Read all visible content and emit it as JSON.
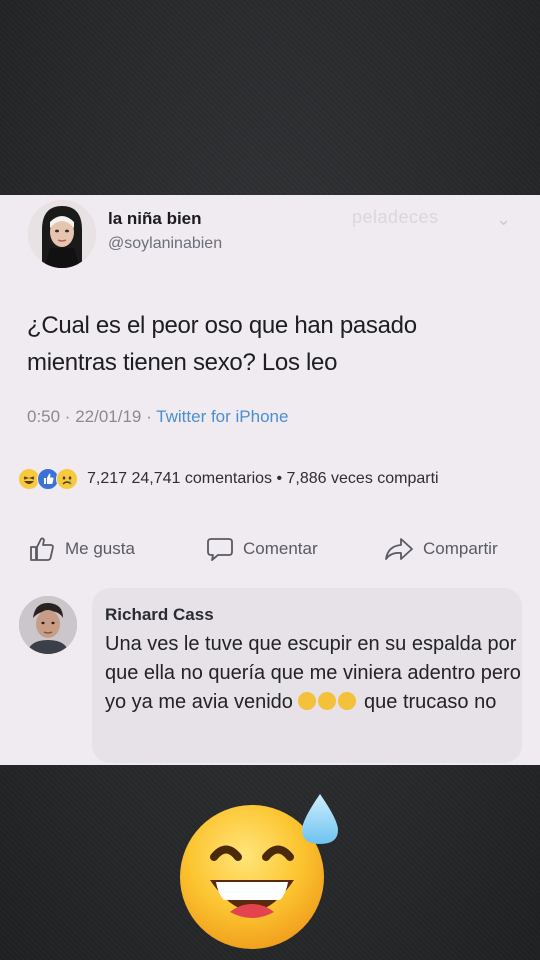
{
  "tweet": {
    "author_name": "la niña bien",
    "author_handle": "@soylaninabien",
    "watermark": "peladeces",
    "text": "¿Cual es el peor oso que han pasado mientras tienen sexo? Los leo",
    "time": "0:50 · 22/01/19 · ",
    "source": "Twitter for iPhone"
  },
  "post_stats": {
    "reactions": [
      "haha-icon",
      "like-icon",
      "sad-icon"
    ],
    "reaction_count": "7,217",
    "comments_text": "24,741 comentarios",
    "shares_text": "7,886 veces comparti"
  },
  "actions": {
    "like_label": "Me gusta",
    "comment_label": "Comentar",
    "share_label": "Compartir"
  },
  "comment": {
    "author": "Richard Cass",
    "text": "Una ves le tuve que escupir en su espalda por que ella no quería que me viniera adentro  pero yo ya me avia venido",
    "text_after_emoji": "que trucaso no",
    "inline_emoji_count": 3
  },
  "colors": {
    "card_bg": "#efebf0",
    "link_blue": "#4a8fd1",
    "like_blue": "#3a72d8",
    "emoji_yellow": "#f7c93c"
  }
}
